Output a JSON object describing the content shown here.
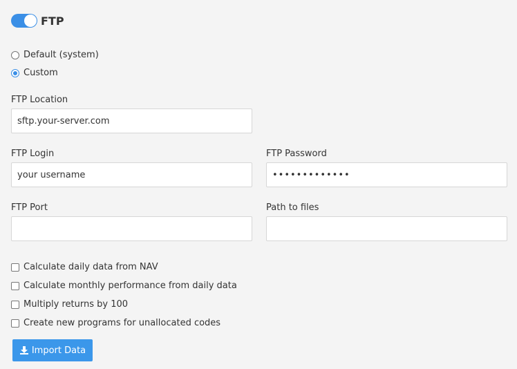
{
  "header": {
    "title": "FTP",
    "toggle_on": true
  },
  "source": {
    "options": [
      {
        "label": "Default (system)",
        "checked": false
      },
      {
        "label": "Custom",
        "checked": true
      }
    ]
  },
  "fields": {
    "location": {
      "label": "FTP Location",
      "value": "sftp.your-server.com"
    },
    "login": {
      "label": "FTP Login",
      "value": "your username"
    },
    "password": {
      "label": "FTP Password",
      "value": "•••••••••••••"
    },
    "port": {
      "label": "FTP Port",
      "value": ""
    },
    "path": {
      "label": "Path to files",
      "value": ""
    }
  },
  "checkboxes": [
    {
      "label": "Calculate daily data from NAV",
      "checked": false
    },
    {
      "label": "Calculate monthly performance from daily data",
      "checked": false
    },
    {
      "label": "Multiply returns by 100",
      "checked": false
    },
    {
      "label": "Create new programs for unallocated codes",
      "checked": false
    }
  ],
  "actions": {
    "import_label": "Import Data",
    "import_icon": "download-icon"
  },
  "colors": {
    "accent": "#3b8fe6",
    "button": "#3b97ea",
    "background": "#f4f4f4"
  }
}
